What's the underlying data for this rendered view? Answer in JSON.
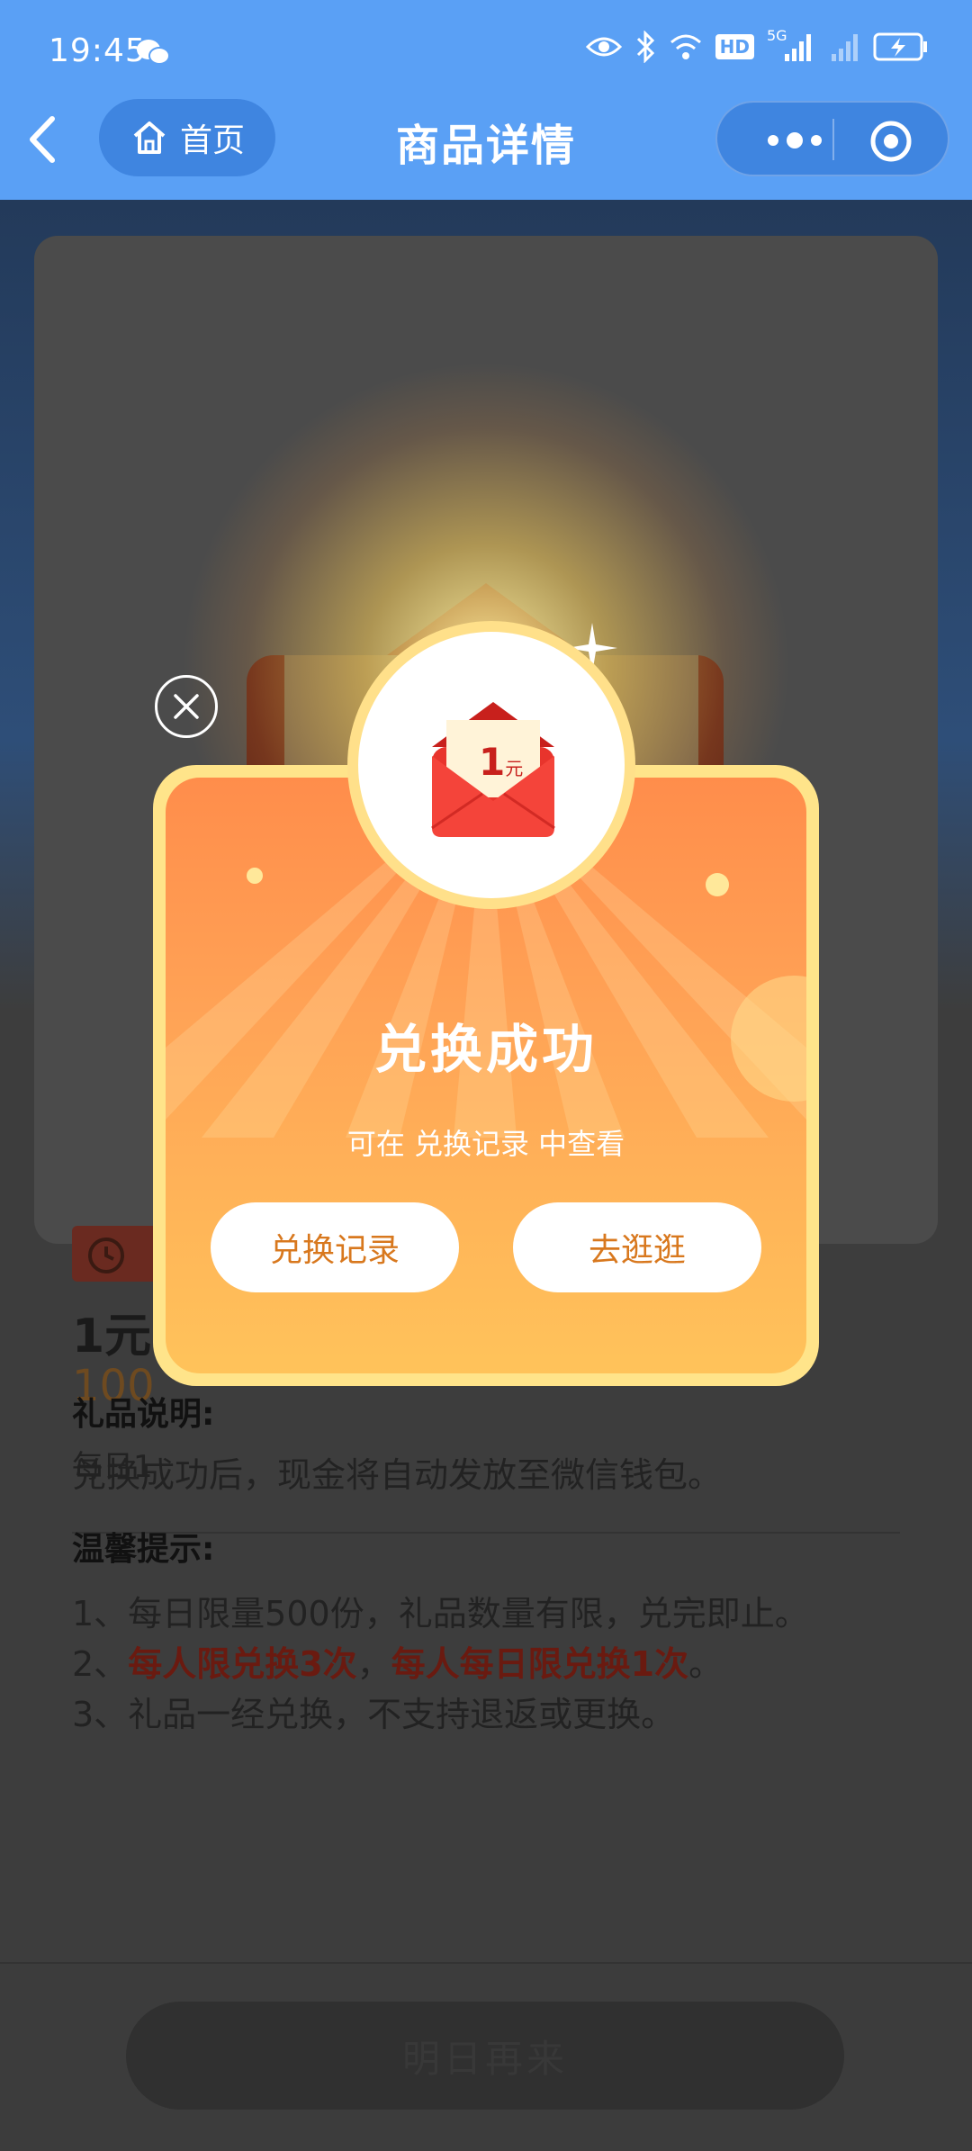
{
  "status_bar": {
    "time": "19:45",
    "network_label": "5G",
    "hd_label": "HD"
  },
  "nav": {
    "home_label": "首页",
    "title": "商品详情"
  },
  "background_page": {
    "envelope_value": "1",
    "product_title": "1元",
    "price_text": "100",
    "daily_text": "每日1",
    "gift_desc_heading": "礼品说明:",
    "gift_desc_text": "兑换成功后，现金将自动发放至微信钱包。",
    "tips_heading": "温馨提示:",
    "tip1": "1、每日限量500份，礼品数量有限，兑完即止。",
    "tip2_prefix": "2、",
    "tip2_part1": "每人限兑换3次",
    "tip2_sep": "，",
    "tip2_part2": "每人每日限兑换1次",
    "tip2_end": "。",
    "tip3": "3、礼品一经兑换，不支持退返或更换。",
    "bottom_button": "明日再来"
  },
  "modal": {
    "badge_amount": "1",
    "badge_unit": "元",
    "title": "兑换成功",
    "subtitle": "可在 兑换记录 中查看",
    "record_button": "兑换记录",
    "browse_button": "去逛逛"
  },
  "colors": {
    "nav_bg": "#5aa0f5",
    "modal_gradient_top": "#ff8d4b",
    "modal_gradient_bottom": "#ffc35a",
    "modal_border": "#ffe48a",
    "button_text": "#d8781e"
  }
}
